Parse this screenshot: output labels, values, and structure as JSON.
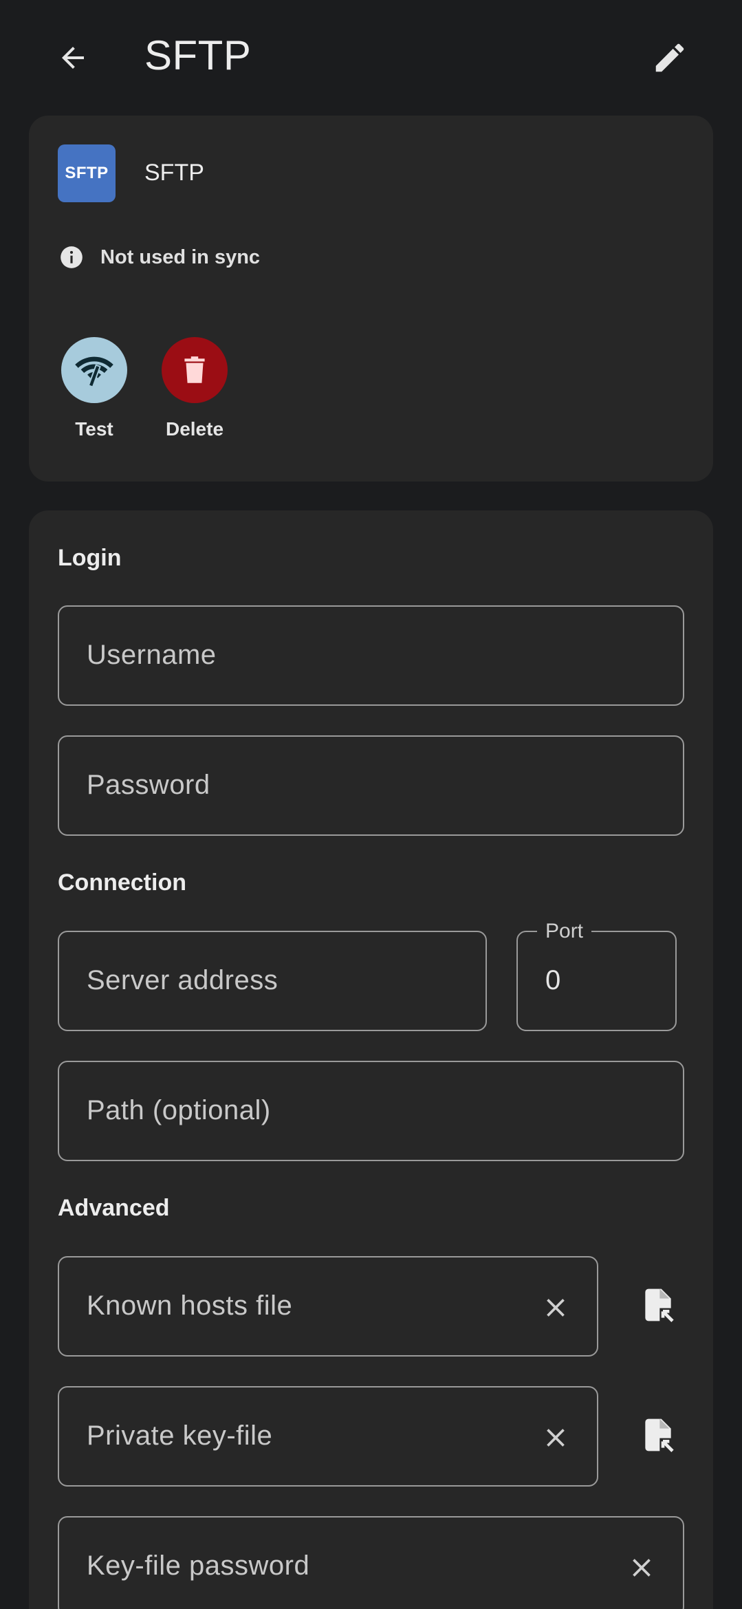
{
  "appbar": {
    "title": "SFTP",
    "back_icon": "arrow-back-icon",
    "edit_icon": "pencil-icon"
  },
  "provider": {
    "logo_text": "SFTP",
    "name": "SFTP",
    "status_text": "Not used in sync",
    "colors": {
      "logo": "#4573c2"
    }
  },
  "actions": {
    "test_label": "Test",
    "delete_label": "Delete",
    "colors": {
      "test": "#a7cbdc",
      "delete": "#9b0d14"
    }
  },
  "sections": {
    "login": "Login",
    "connection": "Connection",
    "advanced": "Advanced"
  },
  "fields": {
    "username_placeholder": "Username",
    "password_placeholder": "Password",
    "server_placeholder": "Server address",
    "port_label": "Port",
    "port_value": "0",
    "path_placeholder": "Path (optional)",
    "known_hosts_placeholder": "Known hosts file",
    "private_key_placeholder": "Private key-file",
    "key_password_placeholder": "Key-file password"
  }
}
